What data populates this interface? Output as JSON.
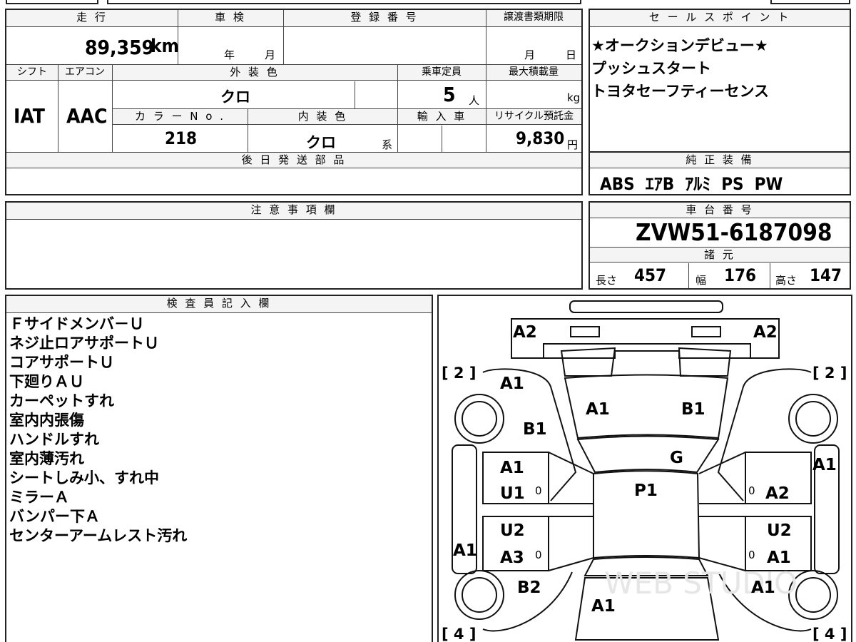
{
  "main_table": {
    "mileage_header": "走 行",
    "mileage_value": "89,359",
    "mileage_unit": "km",
    "shaken_header": "車 検",
    "shaken_year_unit": "年",
    "shaken_month_unit": "月",
    "registration_header": "登 録 番 号",
    "transfer_deadline_header": "譲渡書類期限",
    "transfer_month_unit": "月",
    "transfer_day_unit": "日",
    "shift_header": "シフト",
    "shift_value": "IAT",
    "ac_header": "エアコン",
    "ac_value": "AAC",
    "exterior_color_header": "外 装 色",
    "exterior_color_value": "クロ",
    "capacity_header": "乗車定員",
    "capacity_value": "5",
    "capacity_unit": "人",
    "max_load_header": "最大積載量",
    "max_load_unit": "kg",
    "color_no_header": "カ ラ ー N o .",
    "color_no_value": "218",
    "interior_color_header": "内 装 色",
    "interior_color_value": "クロ",
    "interior_color_unit": "系",
    "import_header": "輸 入 車",
    "recycle_header": "リサイクル預託金",
    "recycle_value": "9,830",
    "recycle_unit": "円",
    "later_parts_header": "後 日 発 送 部 品"
  },
  "sales_points": {
    "header": "セ ー ル ス ポ イ ン ト",
    "lines": [
      "★オークションデビュー★",
      "プッシュスタート",
      "トヨタセーフティーセンス"
    ]
  },
  "genuine_equipment": {
    "header": "純 正 装 備",
    "value": "ABS  ｴｱB  ｱﾙﾐ  PS  PW"
  },
  "notes": {
    "header": "注 意 事 項 欄"
  },
  "chassis": {
    "header": "車 台 番 号",
    "value": "ZVW51-6187098",
    "specs_header": "諸 元",
    "length_label": "長さ",
    "length_value": "457",
    "width_label": "幅",
    "width_value": "176",
    "height_label": "高さ",
    "height_value": "147"
  },
  "inspector": {
    "header": "検 査 員 記 入 欄",
    "lines": [
      "Ｆサイドメンバ－Ｕ",
      "ネジ止ロアサポートＵ",
      "コアサポートＵ",
      "下廻りＡＵ",
      "カーペットすれ",
      "室内内張傷",
      "ハンドルすれ",
      "室内薄汚れ",
      "シートしみ小、すれ中",
      "ミラーＡ",
      "バンパー下Ａ",
      "センターアームレスト汚れ"
    ]
  },
  "diagram": {
    "watermark": "WEB STUDIO",
    "marks": {
      "front_left_bumper": "A2",
      "front_right_bumper": "A2",
      "front_left_fender": "A1",
      "hood_left": "A1",
      "hood_right": "B1",
      "front_left_wheel_area": "B1",
      "windshield": "G",
      "roof": "P1",
      "front_left_door_1": "A1",
      "front_left_door_2": "U1",
      "rear_left_door_1": "U2",
      "rear_left_door_2": "A3",
      "left_rocker": "A1",
      "right_front_outer": "A1",
      "front_right_door": "A2",
      "rear_right_door_1": "U2",
      "rear_right_door_2": "A1",
      "rear_left_quarter": "B2",
      "rear_right_quarter": "A1",
      "trunk": "A1",
      "door_zero_1": "0",
      "door_zero_2": "0",
      "door_zero_3": "0",
      "door_zero_4": "0",
      "tire_fl": "[ 2 ]",
      "tire_fr": "[ 2 ]",
      "tire_rl": "[ 4 ]",
      "tire_rr": "[ 4 ]"
    }
  }
}
